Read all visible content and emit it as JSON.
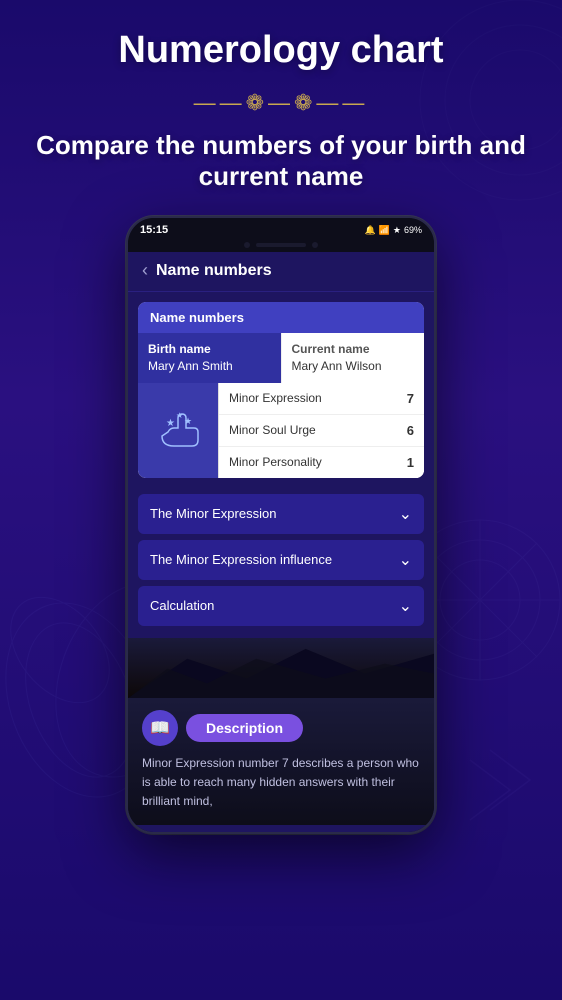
{
  "page": {
    "title": "Numerology chart",
    "subtitle": "Compare the numbers of your birth and current name",
    "background_color": "#1a0a6b"
  },
  "phone": {
    "status_bar": {
      "time": "15:15",
      "battery": "69%"
    },
    "header": {
      "back_label": "‹",
      "title": "Name numbers"
    },
    "card": {
      "header_label": "Name numbers",
      "birth_name_label": "Birth name",
      "birth_name_value": "Mary Ann Smith",
      "current_name_label": "Current name",
      "current_name_value": "Mary Ann Wilson"
    },
    "numbers": [
      {
        "label": "Minor Expression",
        "value": "7"
      },
      {
        "label": "Minor Soul Urge",
        "value": "6"
      },
      {
        "label": "Minor Personality",
        "value": "1"
      }
    ],
    "accordions": [
      {
        "label": "The Minor Expression"
      },
      {
        "label": "The Minor Expression influence"
      },
      {
        "label": "Calculation"
      }
    ],
    "description": {
      "badge_label": "Description",
      "text": "Minor Expression number 7 describes a person who is able to reach many hidden answers with their brilliant mind,"
    }
  }
}
